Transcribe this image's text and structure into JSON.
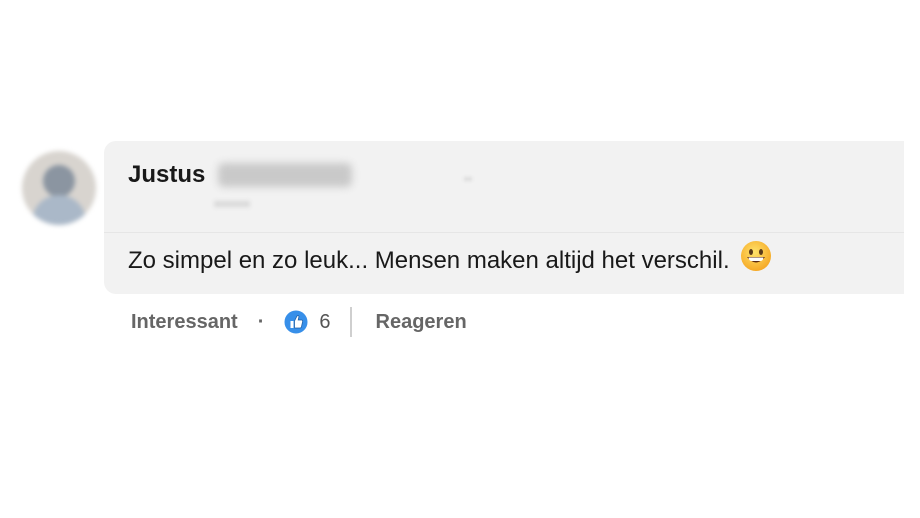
{
  "comment": {
    "author_first_name": "Justus",
    "text": "Zo simpel en zo leuk... Mensen maken altijd het verschil.",
    "emoji": "grinning-face"
  },
  "actions": {
    "react_label": "Interessant",
    "separator": "·",
    "reaction_icon": "thumbs-up-icon",
    "reaction_count": "6",
    "reply_label": "Reageren"
  },
  "colors": {
    "bubble": "#f2f2f2",
    "action_text": "#666666",
    "like_blue": "#378fe9"
  }
}
